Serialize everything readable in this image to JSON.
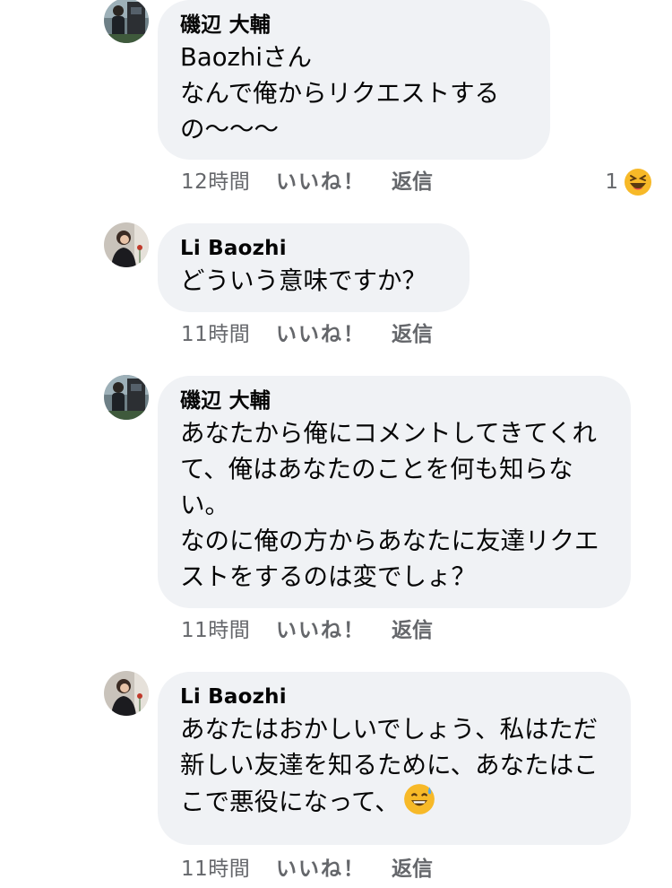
{
  "comments": [
    {
      "author": "磯辺 大輔",
      "text": "Baozhiさん\nなんで俺からリクエストするの〜〜〜",
      "time": "12時間",
      "like_label": "いいね！",
      "reply_label": "返信",
      "reaction_count": "1",
      "reaction_icon": "laughing-emoji-icon"
    },
    {
      "author": "Li Baozhi",
      "text": "どういう意味ですか？",
      "time": "11時間",
      "like_label": "いいね！",
      "reply_label": "返信"
    },
    {
      "author": "磯辺 大輔",
      "text": "あなたから俺にコメントしてきてくれて、俺はあなたのことを何も知らない。\nなのに俺の方からあなたに友達リクエストをするのは変でしょ？",
      "time": "11時間",
      "like_label": "いいね！",
      "reply_label": "返信"
    },
    {
      "author": "Li Baozhi",
      "text": "あなたはおかしいでしょう、私はただ新しい友達を知るために、あなたはここで悪役になって、",
      "text_emoji": "sweat-smile-emoji-icon",
      "time": "11時間",
      "like_label": "いいね！",
      "reply_label": "返信"
    }
  ],
  "colors": {
    "bubble": "#f0f2f5",
    "meta_text": "#65676b",
    "text": "#050505"
  }
}
